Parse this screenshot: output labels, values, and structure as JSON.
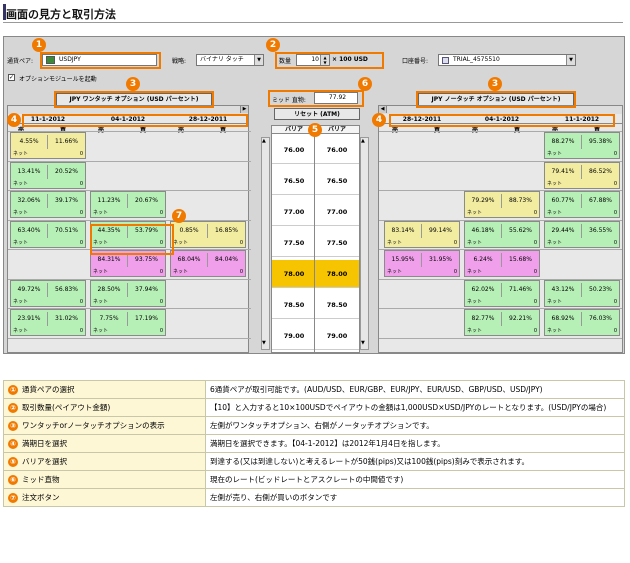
{
  "page_title": "画面の見方と取引方法",
  "app": {
    "pair_label": "通貨ペア:",
    "pair_value": "USDJPY",
    "strategy_label": "戦略:",
    "strategy_value": "バイナリ タッチ",
    "qty_label": "数量",
    "qty_value": "10",
    "qty_unit": "× 100 USD",
    "account_label": "口座番号:",
    "account_value": "TRIAL_4575510",
    "option_module_label": "オプションモジュールを起動",
    "mid_label": "ミッド 直物:",
    "mid_value": "77.92",
    "reset_label": "リセット (ATM)",
    "one_touch_label": "JPY ワンタッチ オプション (USD パーセント)",
    "no_touch_label": "JPY ノータッチ オプション (USD パーセント)",
    "left_dates": [
      "11-1-2012",
      "04-1-2012",
      "28-12-2011"
    ],
    "right_dates": [
      "28-12-2011",
      "04-1-2012",
      "11-1-2012"
    ],
    "sell": "売",
    "buy": "買",
    "barrier_label": "バリア",
    "barriers": [
      "76.00",
      "76.50",
      "77.00",
      "77.50",
      "78.00",
      "78.50",
      "79.00"
    ],
    "net": "ネット",
    "zero": "0",
    "markers": [
      "1",
      "2",
      "3",
      "3",
      "4",
      "4",
      "5",
      "6",
      "7"
    ]
  },
  "left_cells": [
    {
      "row": 0,
      "col": 0,
      "a": "4.55%",
      "b": "11.66%",
      "color": "yellow"
    },
    {
      "row": 1,
      "col": 0,
      "a": "13.41%",
      "b": "20.52%",
      "color": "green"
    },
    {
      "row": 2,
      "col": 0,
      "a": "32.06%",
      "b": "39.17%",
      "color": "green"
    },
    {
      "row": 2,
      "col": 1,
      "a": "11.23%",
      "b": "20.67%",
      "color": "green"
    },
    {
      "row": 3,
      "col": 0,
      "a": "63.40%",
      "b": "70.51%",
      "color": "green"
    },
    {
      "row": 3,
      "col": 1,
      "a": "44.35%",
      "b": "53.79%",
      "color": "green"
    },
    {
      "row": 3,
      "col": 2,
      "a": "0.85%",
      "b": "16.85%",
      "color": "yellow"
    },
    {
      "row": 4,
      "col": 1,
      "a": "84.31%",
      "b": "93.75%",
      "color": "pink"
    },
    {
      "row": 4,
      "col": 2,
      "a": "68.04%",
      "b": "84.04%",
      "color": "pink"
    },
    {
      "row": 5,
      "col": 0,
      "a": "49.72%",
      "b": "56.83%",
      "color": "green"
    },
    {
      "row": 5,
      "col": 1,
      "a": "28.50%",
      "b": "37.94%",
      "color": "green"
    },
    {
      "row": 6,
      "col": 0,
      "a": "23.91%",
      "b": "31.02%",
      "color": "green"
    },
    {
      "row": 6,
      "col": 1,
      "a": "7.75%",
      "b": "17.19%",
      "color": "green"
    }
  ],
  "right_cells": [
    {
      "row": 0,
      "col": 2,
      "a": "88.27%",
      "b": "95.38%",
      "color": "green"
    },
    {
      "row": 1,
      "col": 2,
      "a": "79.41%",
      "b": "86.52%",
      "color": "yellow"
    },
    {
      "row": 2,
      "col": 1,
      "a": "79.29%",
      "b": "88.73%",
      "color": "yellow"
    },
    {
      "row": 2,
      "col": 2,
      "a": "60.77%",
      "b": "67.88%",
      "color": "green"
    },
    {
      "row": 3,
      "col": 0,
      "a": "83.14%",
      "b": "99.14%",
      "color": "yellow"
    },
    {
      "row": 3,
      "col": 1,
      "a": "46.18%",
      "b": "55.62%",
      "color": "green"
    },
    {
      "row": 3,
      "col": 2,
      "a": "29.44%",
      "b": "36.55%",
      "color": "green"
    },
    {
      "row": 4,
      "col": 0,
      "a": "15.95%",
      "b": "31.95%",
      "color": "pink"
    },
    {
      "row": 4,
      "col": 1,
      "a": "6.24%",
      "b": "15.68%",
      "color": "pink"
    },
    {
      "row": 5,
      "col": 1,
      "a": "62.02%",
      "b": "71.46%",
      "color": "green"
    },
    {
      "row": 5,
      "col": 2,
      "a": "43.12%",
      "b": "50.23%",
      "color": "green"
    },
    {
      "row": 6,
      "col": 1,
      "a": "82.77%",
      "b": "92.21%",
      "color": "green"
    },
    {
      "row": 6,
      "col": 2,
      "a": "68.92%",
      "b": "76.03%",
      "color": "green"
    }
  ],
  "description": [
    {
      "num": "①",
      "key": "通貨ペアの選択",
      "text": "6通貨ペアが取引可能です。(AUD/USD、EUR/GBP、EUR/JPY、EUR/USD、GBP/USD、USD/JPY)"
    },
    {
      "num": "②",
      "key": "取引数量(ペイアウト金額)",
      "text": "【10】と入力すると10×100USDでペイアウトの金額は1,000USD×USD/JPYのレートとなります。(USD/JPYの場合)"
    },
    {
      "num": "③",
      "key": "ワンタッチorノータッチオプションの表示",
      "text": "左側がワンタッチオプション、右側がノータッチオプションです。"
    },
    {
      "num": "④",
      "key": "満期日を選択",
      "text": "満期日を選択できます。【04-1-2012】は2012年1月4日を指します。"
    },
    {
      "num": "⑤",
      "key": "バリアを選択",
      "text": "到達する(又は到達しない)と考えるレートが50銭(pips)又は100銭(pips)刻みで表示されます。"
    },
    {
      "num": "⑥",
      "key": "ミッド直物",
      "text": "現在のレート(ビッドレートとアスクレートの中間値です)"
    },
    {
      "num": "⑦",
      "key": "注文ボタン",
      "text": "左側が売り、右側が買いのボタンです"
    }
  ]
}
